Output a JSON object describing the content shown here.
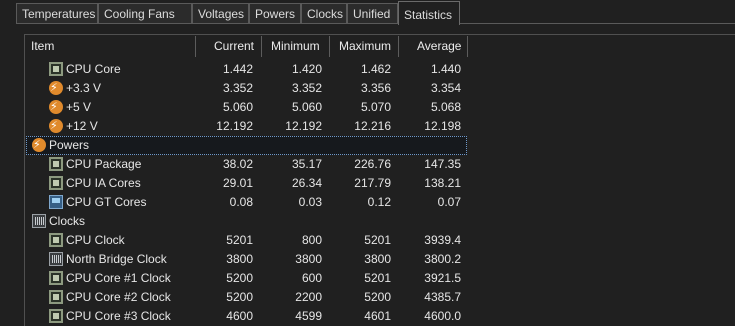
{
  "tabs": [
    "Temperatures",
    "Cooling Fans",
    "Voltages",
    "Powers",
    "Clocks",
    "Unified",
    "Statistics"
  ],
  "columns": {
    "item": "Item",
    "current": "Current",
    "minimum": "Minimum",
    "maximum": "Maximum",
    "average": "Average"
  },
  "rows": [
    {
      "name": "CPU Core",
      "icon": "chip-icon",
      "current": "1.442",
      "minimum": "1.420",
      "maximum": "1.462",
      "average": "1.440"
    },
    {
      "name": "+3.3 V",
      "icon": "power-bolt-icon",
      "current": "3.352",
      "minimum": "3.352",
      "maximum": "3.356",
      "average": "3.354"
    },
    {
      "name": "+5 V",
      "icon": "power-bolt-icon",
      "current": "5.060",
      "minimum": "5.060",
      "maximum": "5.070",
      "average": "5.068"
    },
    {
      "name": "+12 V",
      "icon": "power-bolt-icon",
      "current": "12.192",
      "minimum": "12.192",
      "maximum": "12.216",
      "average": "12.198"
    },
    {
      "name": "Powers",
      "icon": "power-bolt-icon",
      "group": true,
      "selected": true
    },
    {
      "name": "CPU Package",
      "icon": "chip-icon",
      "current": "38.02",
      "minimum": "35.17",
      "maximum": "226.76",
      "average": "147.35"
    },
    {
      "name": "CPU IA Cores",
      "icon": "chip-icon",
      "current": "29.01",
      "minimum": "26.34",
      "maximum": "217.79",
      "average": "138.21"
    },
    {
      "name": "CPU GT Cores",
      "icon": "gpu-icon",
      "current": "0.08",
      "minimum": "0.03",
      "maximum": "0.12",
      "average": "0.07"
    },
    {
      "name": "Clocks",
      "icon": "clock-icon",
      "group": true
    },
    {
      "name": "CPU Clock",
      "icon": "chip-icon",
      "current": "5201",
      "minimum": "800",
      "maximum": "5201",
      "average": "3939.4"
    },
    {
      "name": "North Bridge Clock",
      "icon": "clock-icon",
      "current": "3800",
      "minimum": "3800",
      "maximum": "3800",
      "average": "3800.2"
    },
    {
      "name": "CPU Core #1 Clock",
      "icon": "chip-icon",
      "current": "5200",
      "minimum": "600",
      "maximum": "5201",
      "average": "3921.5"
    },
    {
      "name": "CPU Core #2 Clock",
      "icon": "chip-icon",
      "current": "5200",
      "minimum": "2200",
      "maximum": "5200",
      "average": "4385.7"
    },
    {
      "name": "CPU Core #3 Clock",
      "icon": "chip-icon",
      "current": "4600",
      "minimum": "4599",
      "maximum": "4601",
      "average": "4600.0"
    }
  ]
}
